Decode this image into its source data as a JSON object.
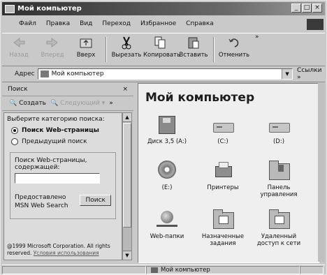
{
  "window": {
    "title": "Мой компьютер",
    "controls": [
      "_",
      "□",
      "×"
    ]
  },
  "menu": [
    "Файл",
    "Правка",
    "Вид",
    "Переход",
    "Избранное",
    "Справка"
  ],
  "toolbar": {
    "back": "Назад",
    "forward": "Вперед",
    "up": "Вверх",
    "cut": "Вырезать",
    "copy": "Копировать",
    "paste": "Вставить",
    "undo": "Отменить",
    "more": "»"
  },
  "address": {
    "label": "Адрес",
    "value": "Мой компьютер",
    "links": "Ссылки »"
  },
  "search_pane": {
    "title": "Поиск",
    "close": "×",
    "new_label": "Создать",
    "next_label": "Следующий",
    "more": "»",
    "prompt": "Выберите категорию поиска:",
    "options": [
      {
        "label": "Поиск Web-страницы",
        "selected": true
      },
      {
        "label": "Предыдущий поиск",
        "selected": false
      }
    ],
    "field_label": "Поиск Web-страницы, содержащей:",
    "field_value": "",
    "provided_by": "Предоставлено MSN Web Search",
    "search_button": "Поиск",
    "copyright": "@1999 Microsoft Corporation. All rights reserved.",
    "terms_link": "Условия использования"
  },
  "content": {
    "heading": "Мой компьютер",
    "items": [
      {
        "label": "Диск 3,5 (A:)",
        "icon": "floppy-drive-icon"
      },
      {
        "label": "(C:)",
        "icon": "hard-drive-icon"
      },
      {
        "label": "(D:)",
        "icon": "hard-drive-icon"
      },
      {
        "label": "(E:)",
        "icon": "cd-drive-icon"
      },
      {
        "label": "Принтеры",
        "icon": "printers-folder-icon"
      },
      {
        "label": "Панель управления",
        "icon": "control-panel-icon"
      },
      {
        "label": "Web-папки",
        "icon": "web-folders-icon"
      },
      {
        "label": "Назначенные задания",
        "icon": "scheduled-tasks-icon"
      },
      {
        "label": "Удаленный доступ к сети",
        "icon": "dial-up-networking-icon"
      }
    ]
  },
  "status": {
    "text": "Мой компьютер"
  }
}
